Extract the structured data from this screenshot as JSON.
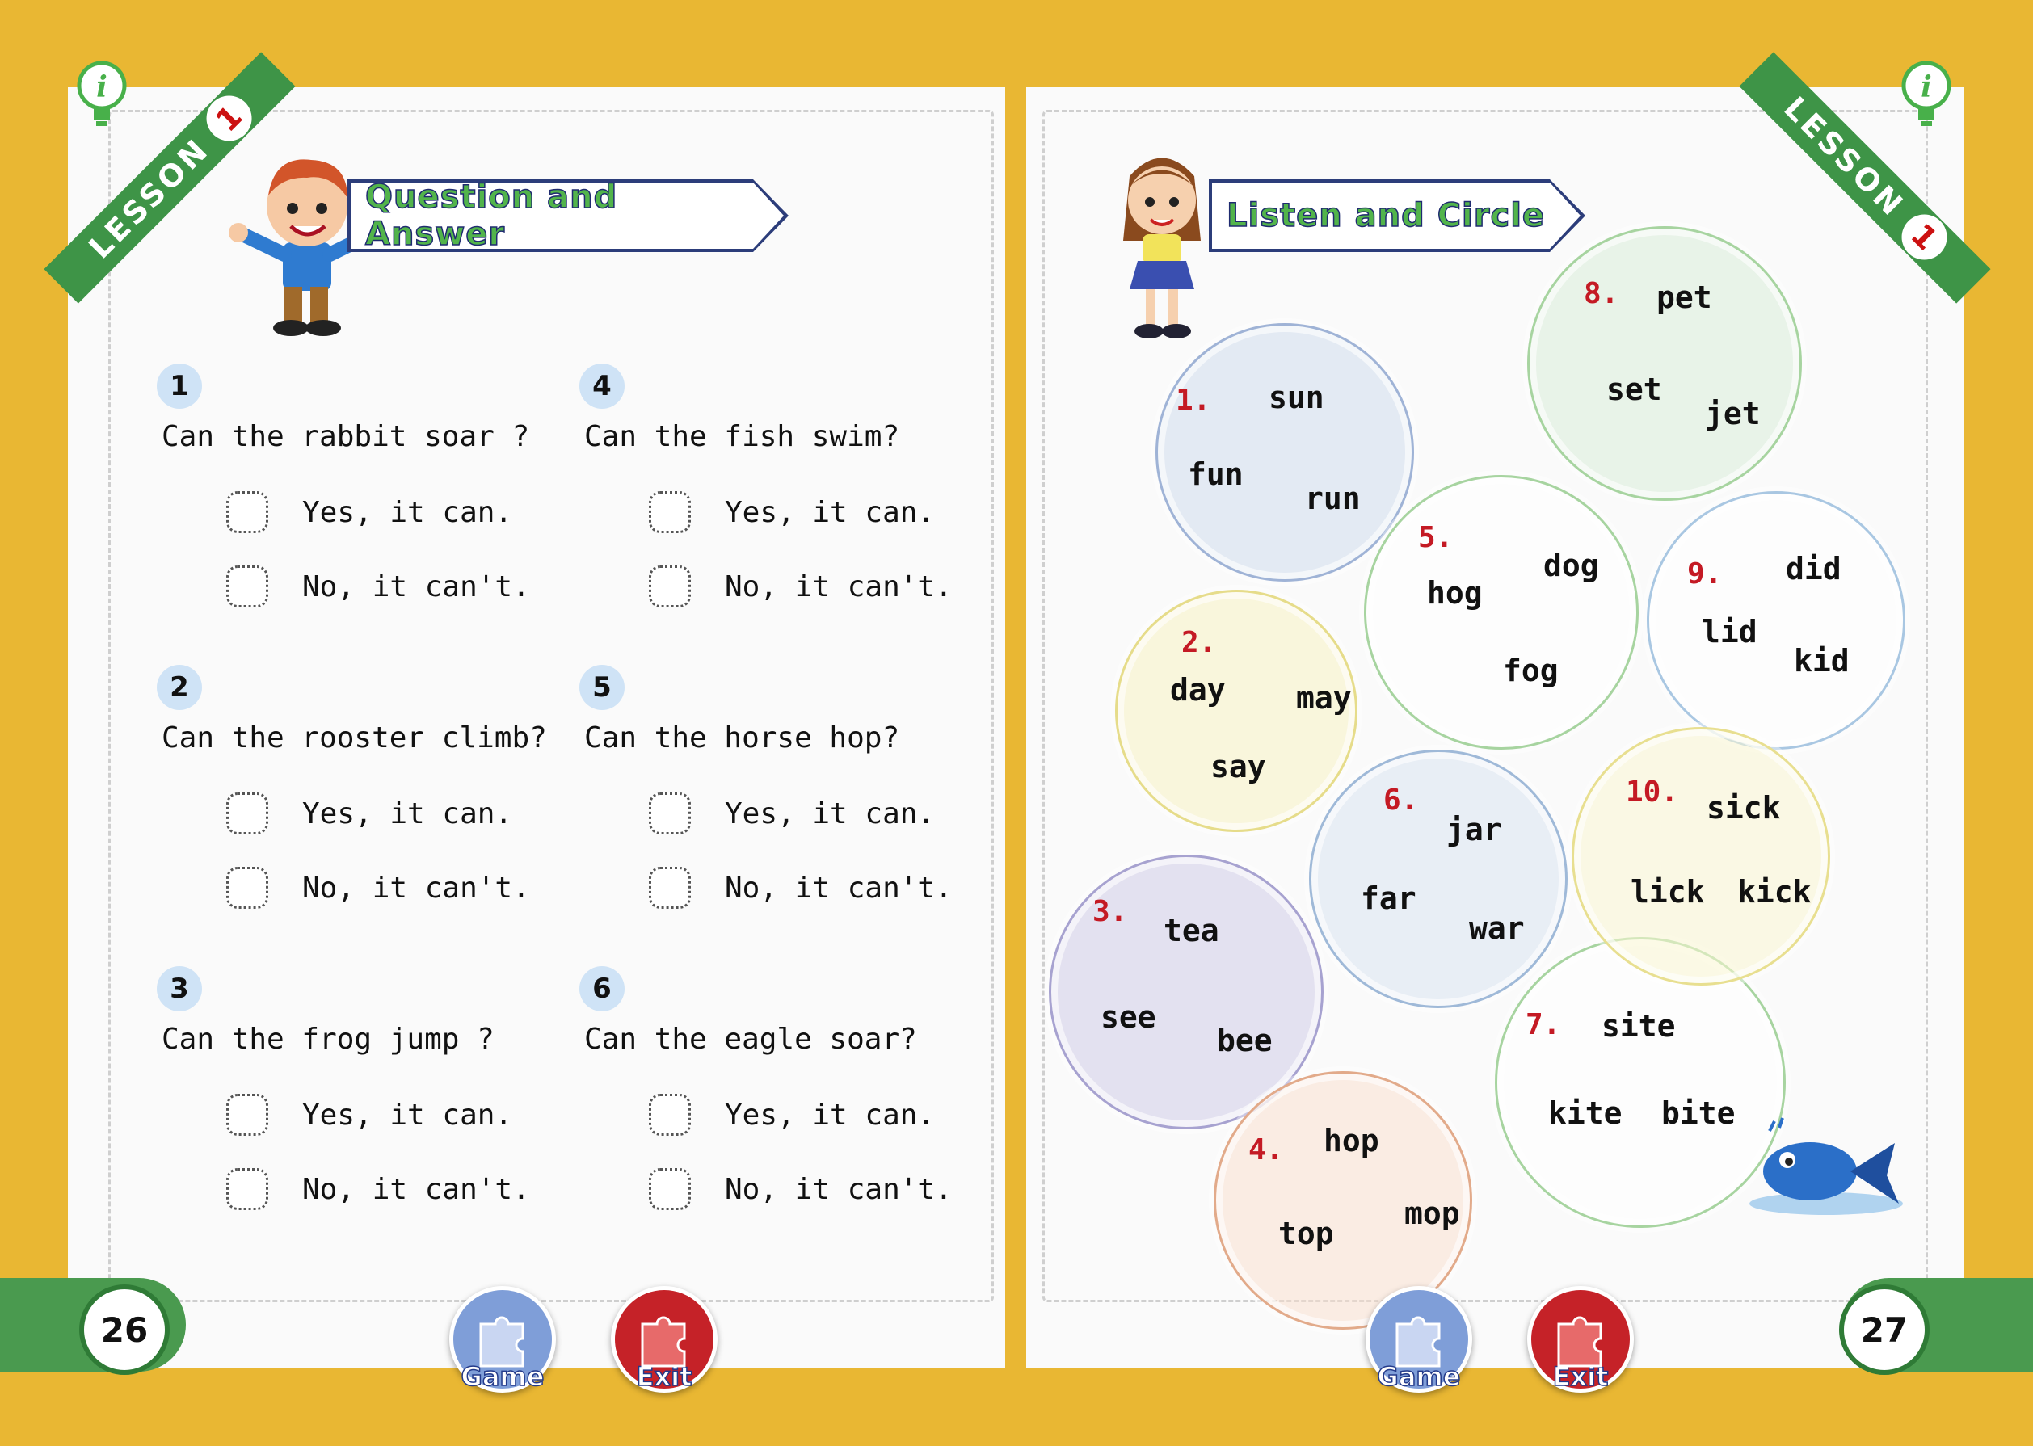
{
  "left_page": {
    "lesson": {
      "label": "LESSON",
      "number": "1"
    },
    "section_title": "Question and Answer",
    "questions": [
      {
        "num": "1",
        "text": "Can the rabbit soar ?",
        "yes": "Yes, it can.",
        "no": "No, it can't."
      },
      {
        "num": "2",
        "text": "Can the rooster climb?",
        "yes": "Yes, it can.",
        "no": "No, it can't."
      },
      {
        "num": "3",
        "text": "Can the frog jump ?",
        "yes": "Yes, it can.",
        "no": "No, it can't."
      },
      {
        "num": "4",
        "text": "Can the fish swim?",
        "yes": "Yes, it can.",
        "no": "No, it can't."
      },
      {
        "num": "5",
        "text": "Can the horse hop?",
        "yes": "Yes, it can.",
        "no": "No, it can't."
      },
      {
        "num": "6",
        "text": "Can the eagle soar?",
        "yes": "Yes, it can.",
        "no": "No, it can't."
      }
    ],
    "page_number": "26",
    "game_label": "Game",
    "exit_label": "Exit"
  },
  "right_page": {
    "lesson": {
      "label": "LESSON",
      "number": "1"
    },
    "section_title": "Listen and Circle",
    "bubbles": [
      {
        "num": "1.",
        "words": [
          "sun",
          "fun",
          "run"
        ]
      },
      {
        "num": "2.",
        "words": [
          "day",
          "may",
          "say"
        ]
      },
      {
        "num": "3.",
        "words": [
          "tea",
          "see",
          "bee"
        ]
      },
      {
        "num": "4.",
        "words": [
          "hop",
          "top",
          "mop"
        ]
      },
      {
        "num": "5.",
        "words": [
          "dog",
          "hog",
          "fog"
        ]
      },
      {
        "num": "6.",
        "words": [
          "jar",
          "far",
          "war"
        ]
      },
      {
        "num": "7.",
        "words": [
          "site",
          "kite",
          "bite"
        ]
      },
      {
        "num": "8.",
        "words": [
          "pet",
          "set",
          "jet"
        ]
      },
      {
        "num": "9.",
        "words": [
          "did",
          "lid",
          "kid"
        ]
      },
      {
        "num": "10.",
        "words": [
          "sick",
          "lick",
          "kick"
        ]
      }
    ],
    "page_number": "27",
    "game_label": "Game",
    "exit_label": "Exit"
  },
  "colors": {
    "background": "#E9B733",
    "lesson_banner": "#3e9447",
    "number_red": "#c41a24",
    "title_green": "#52b44b",
    "title_outline": "#1f2b70"
  }
}
